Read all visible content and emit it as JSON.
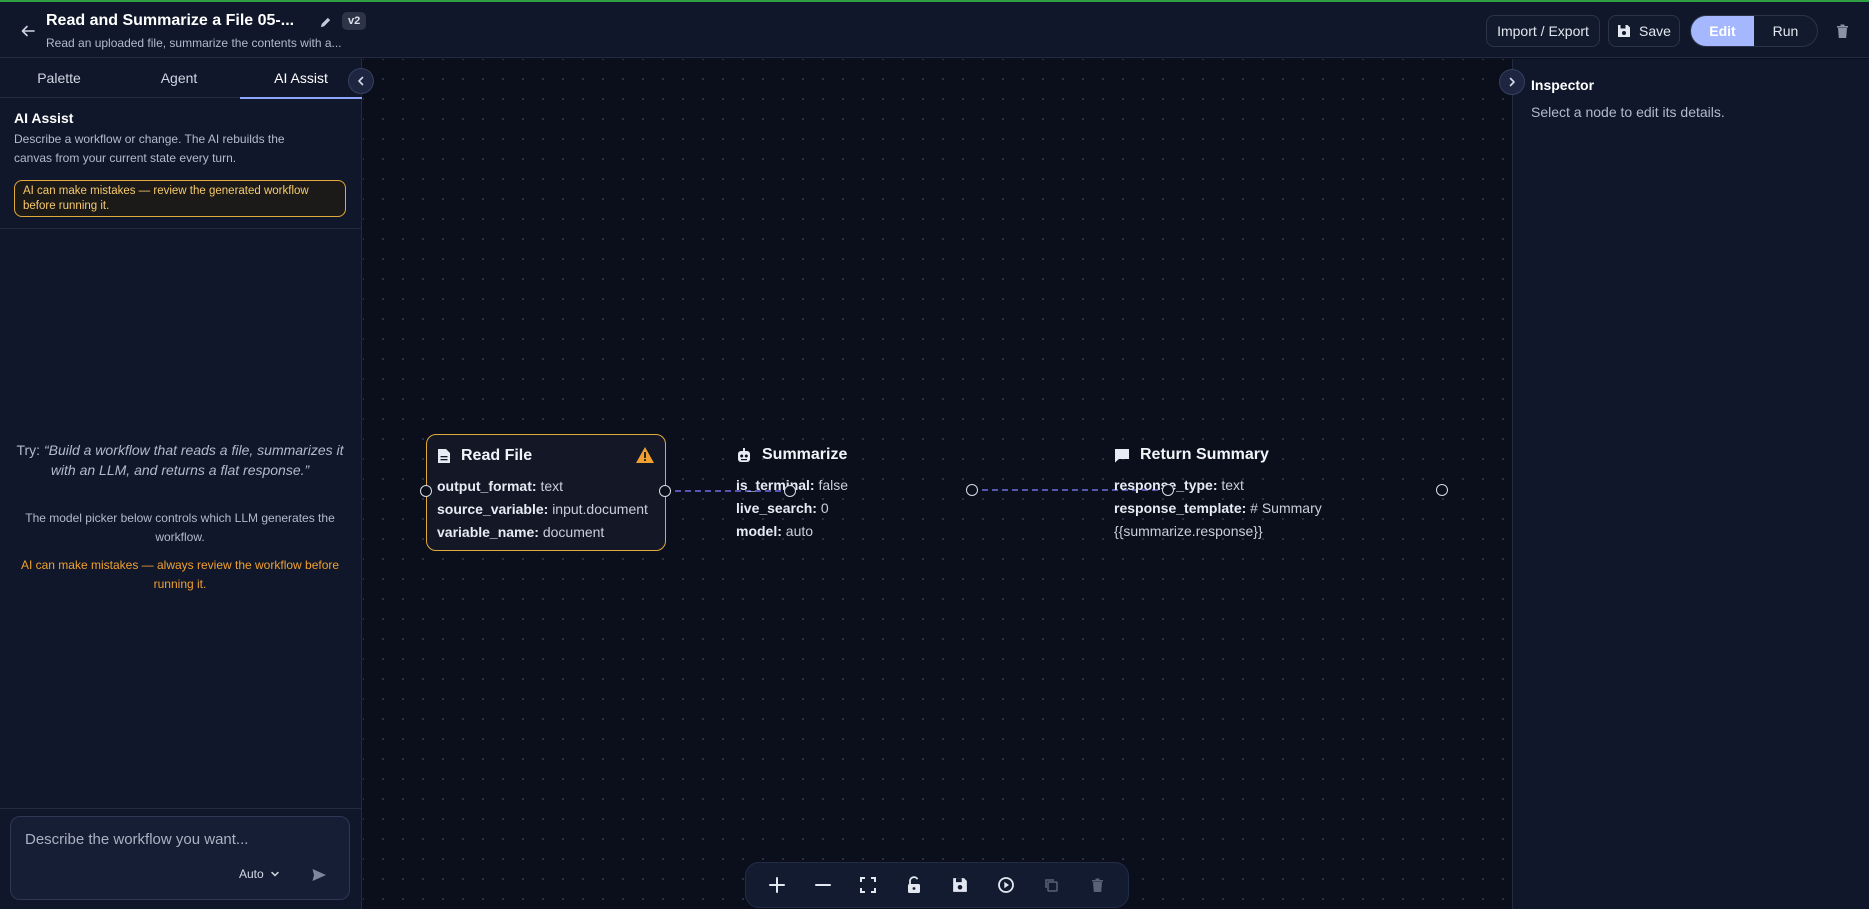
{
  "header": {
    "title": "Read and Summarize a File 05-...",
    "version": "v2",
    "subtitle": "Read an uploaded file, summarize the contents with a...",
    "import_export_label": "Import / Export",
    "save_label": "Save",
    "edit_label": "Edit",
    "run_label": "Run",
    "accent_color": "#a5b8ff"
  },
  "sidebar": {
    "tabs": [
      {
        "label": "Palette"
      },
      {
        "label": "Agent"
      },
      {
        "label": "AI Assist",
        "active": true
      }
    ],
    "ai_assist": {
      "heading": "AI Assist",
      "description": "Describe a workflow or change. The AI rebuilds the canvas from your current state every turn.",
      "warning_box": "AI can make mistakes — review the generated workflow before running it.",
      "try_prefix": "Try: ",
      "try_example": "“Build a workflow that reads a file, summarizes it with an LLM, and returns a flat response.”",
      "model_note": "The model picker below controls which LLM generates the workflow.",
      "warning_text": "AI can make mistakes — always review the workflow before running it.",
      "prompt_placeholder": "Describe the workflow you want...",
      "model": "Auto"
    }
  },
  "canvas": {
    "nodes": [
      {
        "id": "read_file",
        "icon": "document-icon",
        "title": "Read File",
        "has_warning": true,
        "props": [
          {
            "key": "output_format:",
            "value": "text"
          },
          {
            "key": "source_variable:",
            "value": "input.document"
          },
          {
            "key": "variable_name:",
            "value": "document"
          }
        ]
      },
      {
        "id": "summarize",
        "icon": "robot-icon",
        "title": "Summarize",
        "props": [
          {
            "key": "is_terminal:",
            "value": "false"
          },
          {
            "key": "live_search:",
            "value": "0"
          },
          {
            "key": "model:",
            "value": "auto"
          }
        ]
      },
      {
        "id": "return_summary",
        "icon": "chat-icon",
        "title": "Return Summary",
        "props": [
          {
            "key": "response_type:",
            "value": "text"
          },
          {
            "key": "response_template:",
            "value": "# Summary"
          },
          {
            "key": "",
            "value": "{{summarize.response}}"
          }
        ]
      }
    ],
    "warning_color": "#e2a93b",
    "edge_color": "#6c6fe0"
  },
  "toolbar": {
    "tools": [
      "zoom-in-icon",
      "zoom-out-icon",
      "fit-view-icon",
      "unlock-icon",
      "save-icon",
      "run-icon",
      "duplicate-icon",
      "delete-icon"
    ]
  },
  "inspector": {
    "title": "Inspector",
    "hint": "Select a node to edit its details."
  }
}
